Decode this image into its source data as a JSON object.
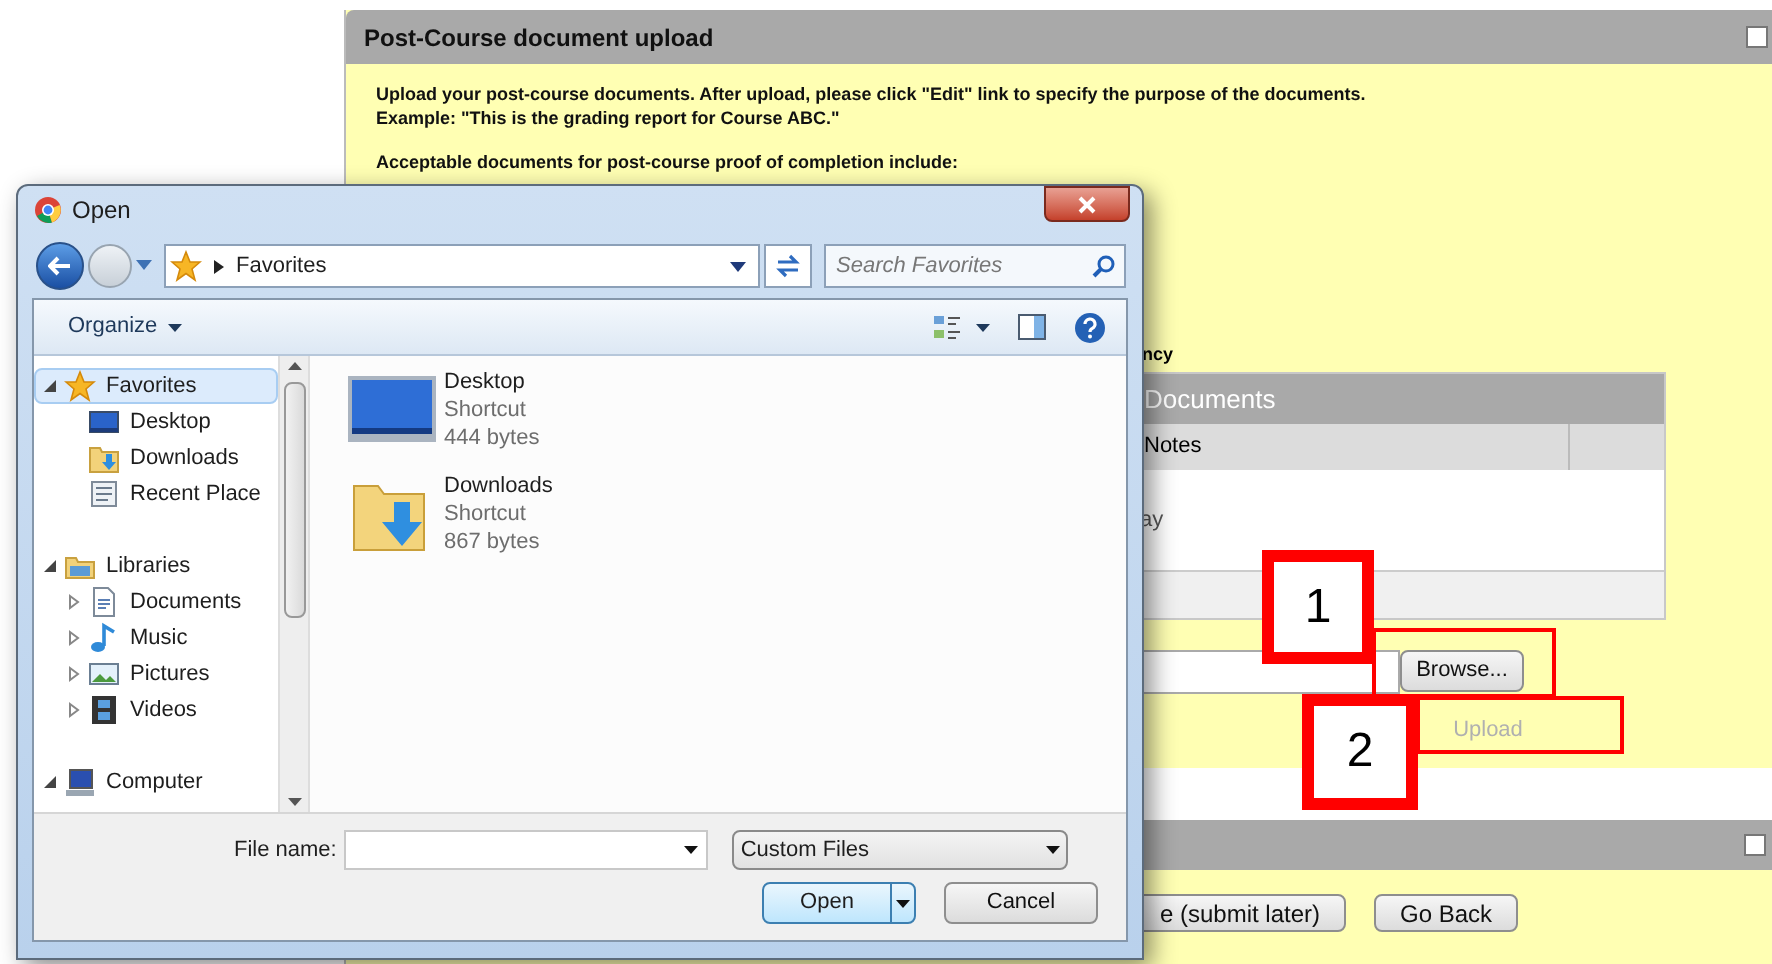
{
  "page": {
    "title": "Post-Course document upload",
    "intro": [
      [
        "Upload your post-course documents. After upload, please click \"Edit\" link to specify the purpose of the documents.",
        "Example: \"This is the grading report for Course ABC.\""
      ],
      [
        "Acceptable documents for post-course proof of completion include:"
      ]
    ],
    "fragment": "ncy",
    "documents_table": {
      "title": "Documents",
      "columns": [
        "Notes"
      ],
      "rows": [
        [
          "ay"
        ]
      ]
    },
    "browse_button": "Browse...",
    "upload_button": {
      "label": "Upload",
      "disabled": true
    },
    "footer_buttons": [
      "e (submit later)",
      "Go Back"
    ]
  },
  "dialog": {
    "title": "Open",
    "address": "Favorites",
    "search": {
      "placeholder": "Search Favorites"
    },
    "organize": "Organize",
    "nav_tree": [
      {
        "label": "Favorites",
        "kind": "star",
        "expanded": true,
        "selected": true,
        "children": [
          {
            "label": "Desktop",
            "kind": "desktop",
            "selected": false
          },
          {
            "label": "Downloads",
            "kind": "downloads",
            "selected": false
          },
          {
            "label": "Recent Place",
            "kind": "recent",
            "selected": false
          }
        ]
      },
      {
        "label": "Libraries",
        "kind": "library",
        "expanded": true,
        "selected": false,
        "children": [
          {
            "label": "Documents",
            "kind": "documents",
            "expanded": false,
            "selected": false
          },
          {
            "label": "Music",
            "kind": "music",
            "expanded": false,
            "selected": false
          },
          {
            "label": "Pictures",
            "kind": "pictures",
            "expanded": false,
            "selected": false
          },
          {
            "label": "Videos",
            "kind": "videos",
            "expanded": false,
            "selected": false
          }
        ]
      },
      {
        "label": "Computer",
        "kind": "computer",
        "expanded": true,
        "selected": false
      }
    ],
    "files": [
      {
        "name": "Desktop",
        "type": "Shortcut",
        "size": "444 bytes",
        "kind": "desktop"
      },
      {
        "name": "Downloads",
        "type": "Shortcut",
        "size": "867 bytes",
        "kind": "downloads"
      }
    ],
    "file_name": {
      "label": "File name:"
    },
    "file_type": "Custom Files",
    "open_button": "Open",
    "cancel_button": "Cancel"
  },
  "callouts": [
    {
      "label": "1"
    },
    {
      "label": "2"
    }
  ]
}
